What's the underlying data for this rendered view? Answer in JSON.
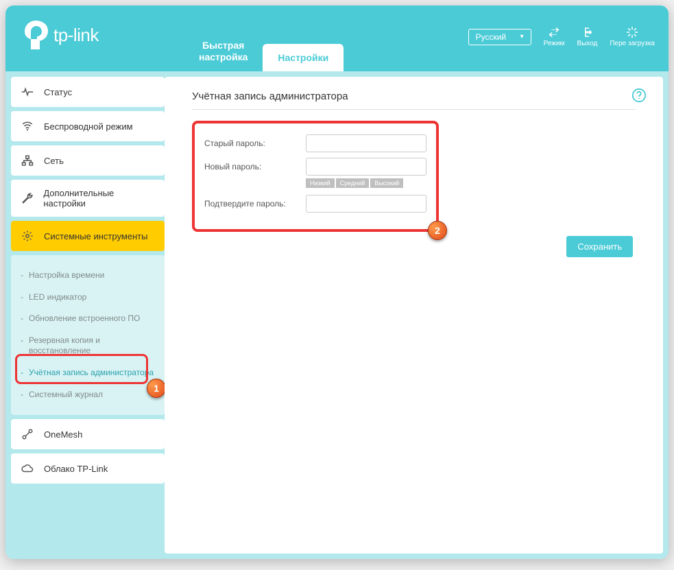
{
  "header": {
    "logo_text": "tp-link",
    "tab_quick": "Быстрая\nнастройка",
    "tab_settings": "Настройки",
    "language": "Русский",
    "btn_mode": "Режим",
    "btn_logout": "Выход",
    "btn_reboot": "Пере загрузка"
  },
  "sidebar": {
    "status": "Статус",
    "wireless": "Беспроводной режим",
    "network": "Сеть",
    "advanced": "Дополнительные настройки",
    "system": "Системные инструменты",
    "sub": {
      "time": "Настройка времени",
      "led": "LED индикатор",
      "firmware": "Обновление встроенного ПО",
      "backup": "Резервная копия и восстановление",
      "admin": "Учётная запись администратора",
      "syslog": "Системный журнал"
    },
    "onemesh": "OneMesh",
    "cloud": "Облако TP-Link"
  },
  "page": {
    "title": "Учётная запись администратора",
    "old_pw": "Старый пароль:",
    "new_pw": "Новый пароль:",
    "confirm_pw": "Подтвердите пароль:",
    "strength_low": "Низкий",
    "strength_mid": "Средний",
    "strength_high": "Высокий",
    "save": "Сохранить"
  },
  "annotations": {
    "balloon1": "1",
    "balloon2": "2"
  }
}
